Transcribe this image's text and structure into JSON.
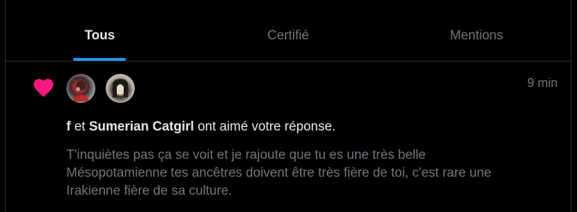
{
  "tabs": [
    {
      "label": "Tous",
      "active": true
    },
    {
      "label": "Certifié",
      "active": false
    },
    {
      "label": "Mentions",
      "active": false
    }
  ],
  "notification": {
    "icon": "heart-icon",
    "icon_color": "#f91880",
    "time": "9 min",
    "user1": "f",
    "connector": "et",
    "user2": "Sumerian Catgirl",
    "action": "ont aimé votre réponse.",
    "reply_text": "T'inquiètes pas ça se voit et je rajoute que tu es une très belle Mésopotamienne tes ancêtres doivent être très fière de toi, c'est rare une Irakienne fière de sa culture."
  },
  "colors": {
    "background": "#000000",
    "accent": "#1d9bf0",
    "text_primary": "#e7e9ea",
    "text_secondary": "#71767b",
    "border": "#2f3336"
  }
}
